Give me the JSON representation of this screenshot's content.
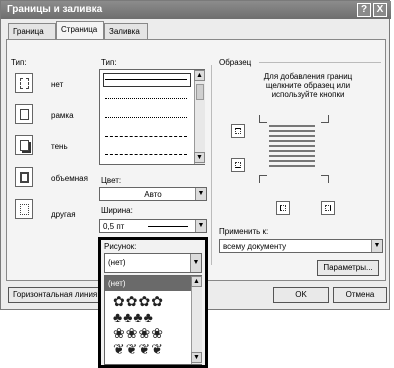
{
  "dialog": {
    "title": "Границы и заливка",
    "help_btn": "?",
    "close_btn": "X",
    "tabs": [
      {
        "label": "Граница"
      },
      {
        "label": "Страница"
      },
      {
        "label": "Заливка"
      }
    ]
  },
  "setting": {
    "heading": "Тип:",
    "items": [
      {
        "label": "нет"
      },
      {
        "label": "рамка"
      },
      {
        "label": "тень"
      },
      {
        "label": "объемная"
      },
      {
        "label": "другая"
      }
    ]
  },
  "style": {
    "heading": "Тип:"
  },
  "color": {
    "label": "Цвет:",
    "value": "Авто"
  },
  "width": {
    "label": "Ширина:",
    "value": "0,5 пт"
  },
  "art": {
    "label": "Рисунок:",
    "value": "(нет)",
    "highlighted_option": "(нет)"
  },
  "preview": {
    "heading": "Образец",
    "hint": "Для добавления границ щелкните образец или используйте кнопки"
  },
  "apply_to": {
    "label": "Применить к:",
    "value": "всему документу"
  },
  "buttons": {
    "options": "Параметры...",
    "horizontal_line": "Горизонтальная линия...",
    "ok": "OK",
    "cancel": "Отмена"
  },
  "glyphs": {
    "scroll_up": "▲",
    "scroll_down": "▼",
    "dropdown": "▼"
  },
  "colors": {
    "titlebar": "#7a7a7a",
    "highlight": "#6a6a6a",
    "popup_border": "#000000"
  }
}
